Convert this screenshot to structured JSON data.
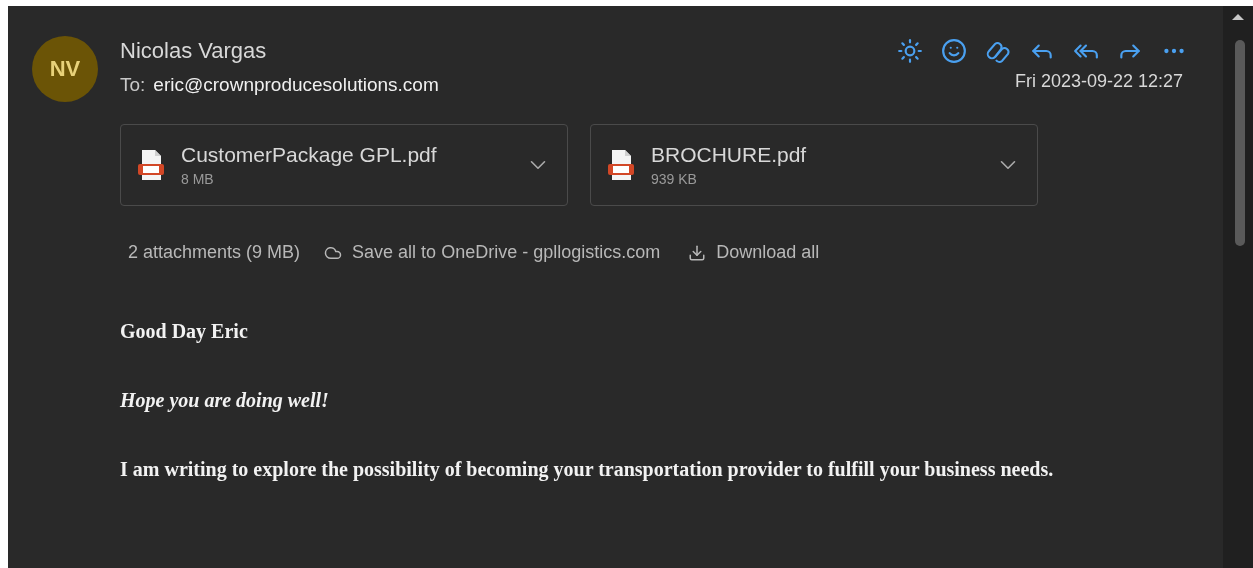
{
  "sender": {
    "initials": "NV",
    "name": "Nicolas Vargas",
    "to_label": "To:",
    "to": "eric@crownproducesolutions.com",
    "date": "Fri 2023-09-22 12:27"
  },
  "toolbar": [
    {
      "kind": "sun"
    },
    {
      "kind": "smile"
    },
    {
      "kind": "loop"
    },
    {
      "kind": "reply"
    },
    {
      "kind": "replyall"
    },
    {
      "kind": "forward"
    },
    {
      "kind": "more"
    }
  ],
  "attachments": [
    {
      "name": "CustomerPackage GPL.pdf",
      "size": "8 MB"
    },
    {
      "name": "BROCHURE.pdf",
      "size": "939 KB"
    }
  ],
  "attachment_bar": {
    "summary": "2 attachments (9 MB)",
    "save": "Save all to OneDrive - gpllogistics.com",
    "download": "Download all"
  },
  "body": [
    {
      "kind": "bold",
      "text": "Good Day Eric"
    },
    {
      "kind": "italic",
      "text": "Hope you are doing well!"
    },
    {
      "kind": "bold",
      "text": "I am writing to explore the possibility of becoming your transportation provider to fulfill your business needs."
    }
  ]
}
